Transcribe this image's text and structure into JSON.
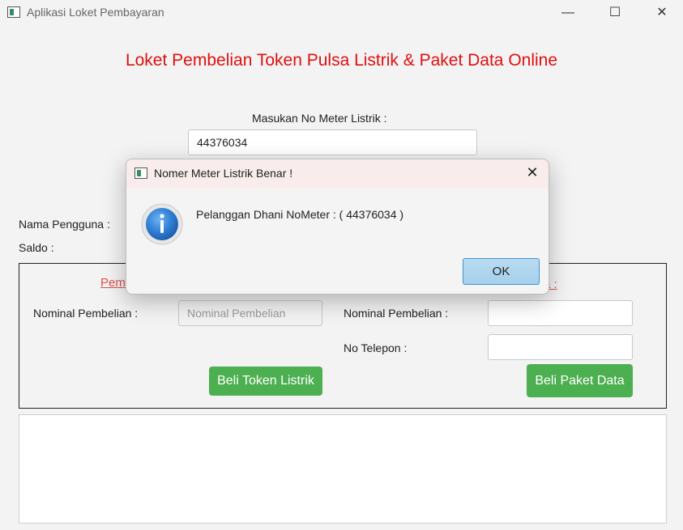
{
  "window": {
    "title": "Aplikasi Loket Pembayaran",
    "minimize_icon": "—",
    "maximize_icon": "☐",
    "close_icon": "✕"
  },
  "main_title": "Loket Pembelian Token Pulsa Listrik & Paket Data Online",
  "meter": {
    "label": "Masukan No Meter Listrik :",
    "value": "44376034"
  },
  "user": {
    "name_label": "Nama Pengguna :",
    "balance_label": "Saldo :"
  },
  "token_section": {
    "title_visible": "Pem",
    "nominal_label": "Nominal Pembelian :",
    "nominal_placeholder": "Nominal Pembelian",
    "buy_button": "Beli Token Listrik"
  },
  "data_section": {
    "title_visible": "a :",
    "nominal_label": "Nominal Pembelian :",
    "phone_label": "No Telepon :",
    "buy_button": "Beli Paket Data"
  },
  "dialog": {
    "title": "Nomer Meter Listrik Benar !",
    "close_icon": "✕",
    "message": "Pelanggan Dhani NoMeter : ( 44376034 )",
    "ok_label": "OK",
    "icon": "info-icon"
  },
  "colors": {
    "title_red": "#e01010",
    "section_red": "#e05050",
    "button_green": "#4caf50",
    "ok_blue": "#a6d0ec"
  }
}
